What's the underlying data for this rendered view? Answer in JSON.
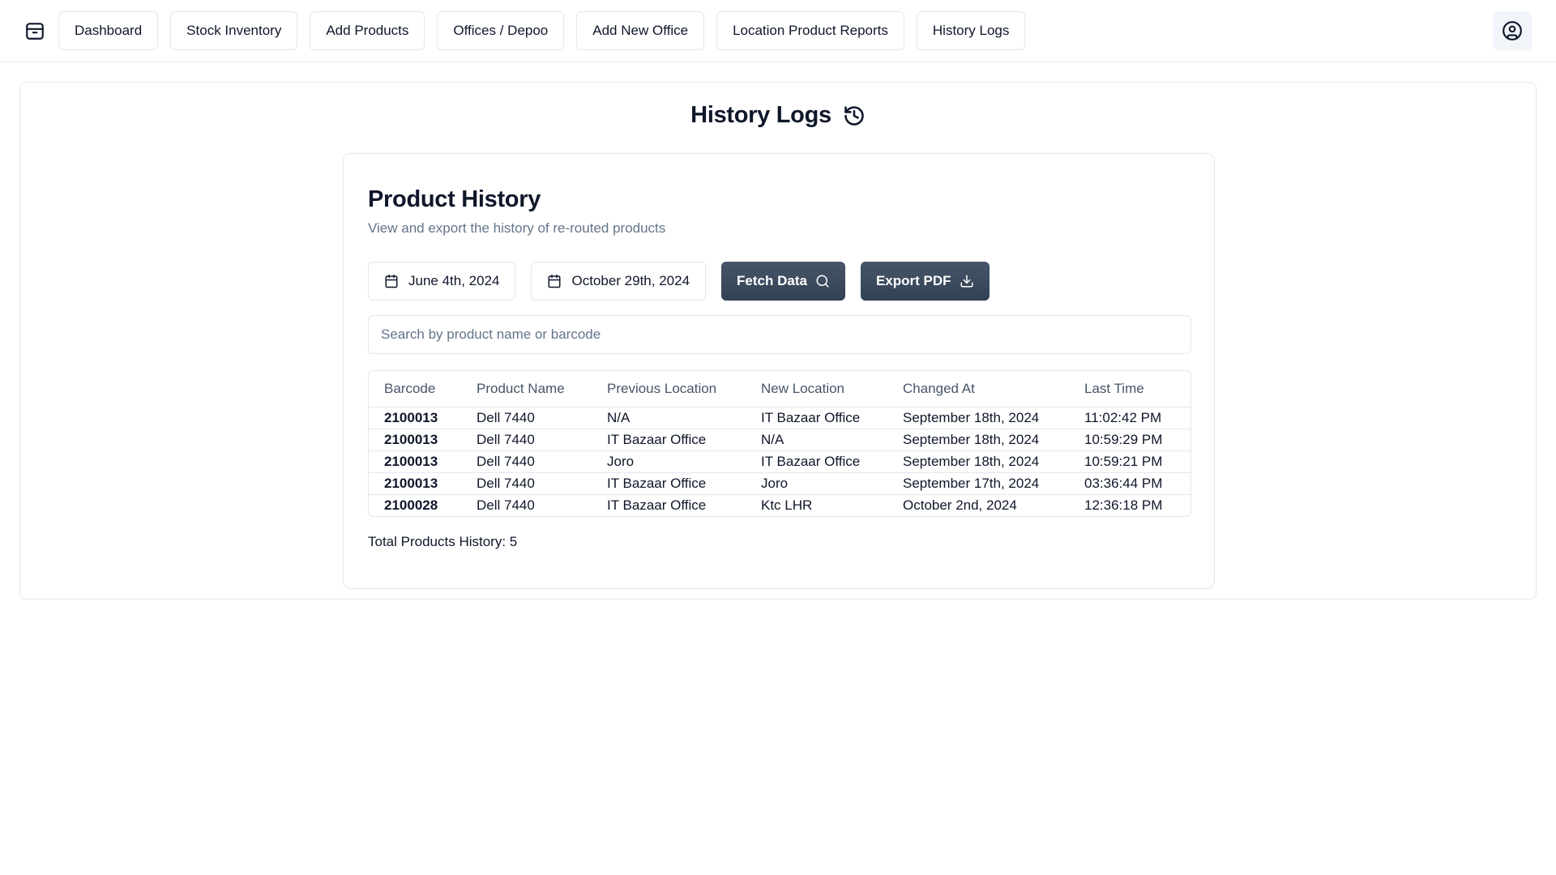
{
  "nav": {
    "items": [
      {
        "label": "Dashboard"
      },
      {
        "label": "Stock Inventory"
      },
      {
        "label": "Add Products"
      },
      {
        "label": "Offices / Depoo"
      },
      {
        "label": "Add New Office"
      },
      {
        "label": "Location Product Reports"
      },
      {
        "label": "History Logs"
      }
    ]
  },
  "page": {
    "title": "History Logs"
  },
  "history": {
    "title": "Product History",
    "subtitle": "View and export the history of re-routed products",
    "start_date": "June 4th, 2024",
    "end_date": "October 29th, 2024",
    "fetch_label": "Fetch Data",
    "export_label": "Export PDF",
    "search_placeholder": "Search by product name or barcode",
    "columns": [
      "Barcode",
      "Product Name",
      "Previous Location",
      "New Location",
      "Changed At",
      "Last Time"
    ],
    "rows": [
      [
        "2100013",
        "Dell 7440",
        "N/A",
        "IT Bazaar Office",
        "September 18th, 2024",
        "11:02:42 PM"
      ],
      [
        "2100013",
        "Dell 7440",
        "IT Bazaar Office",
        "N/A",
        "September 18th, 2024",
        "10:59:29 PM"
      ],
      [
        "2100013",
        "Dell 7440",
        "Joro",
        "IT Bazaar Office",
        "September 18th, 2024",
        "10:59:21 PM"
      ],
      [
        "2100013",
        "Dell 7440",
        "IT Bazaar Office",
        "Joro",
        "September 17th, 2024",
        "03:36:44 PM"
      ],
      [
        "2100028",
        "Dell 7440",
        "IT Bazaar Office",
        "Ktc LHR",
        "October 2nd, 2024",
        "12:36:18 PM"
      ]
    ],
    "total_text": "Total Products History: 5"
  },
  "icons": {
    "logo": "package-icon",
    "profile": "user-circle-icon",
    "history": "history-icon",
    "calendar": "calendar-icon",
    "search": "search-icon",
    "download": "download-icon"
  },
  "colors": {
    "primary_button": "#334155",
    "muted_text": "#64748b",
    "border": "#e2e8f0"
  }
}
